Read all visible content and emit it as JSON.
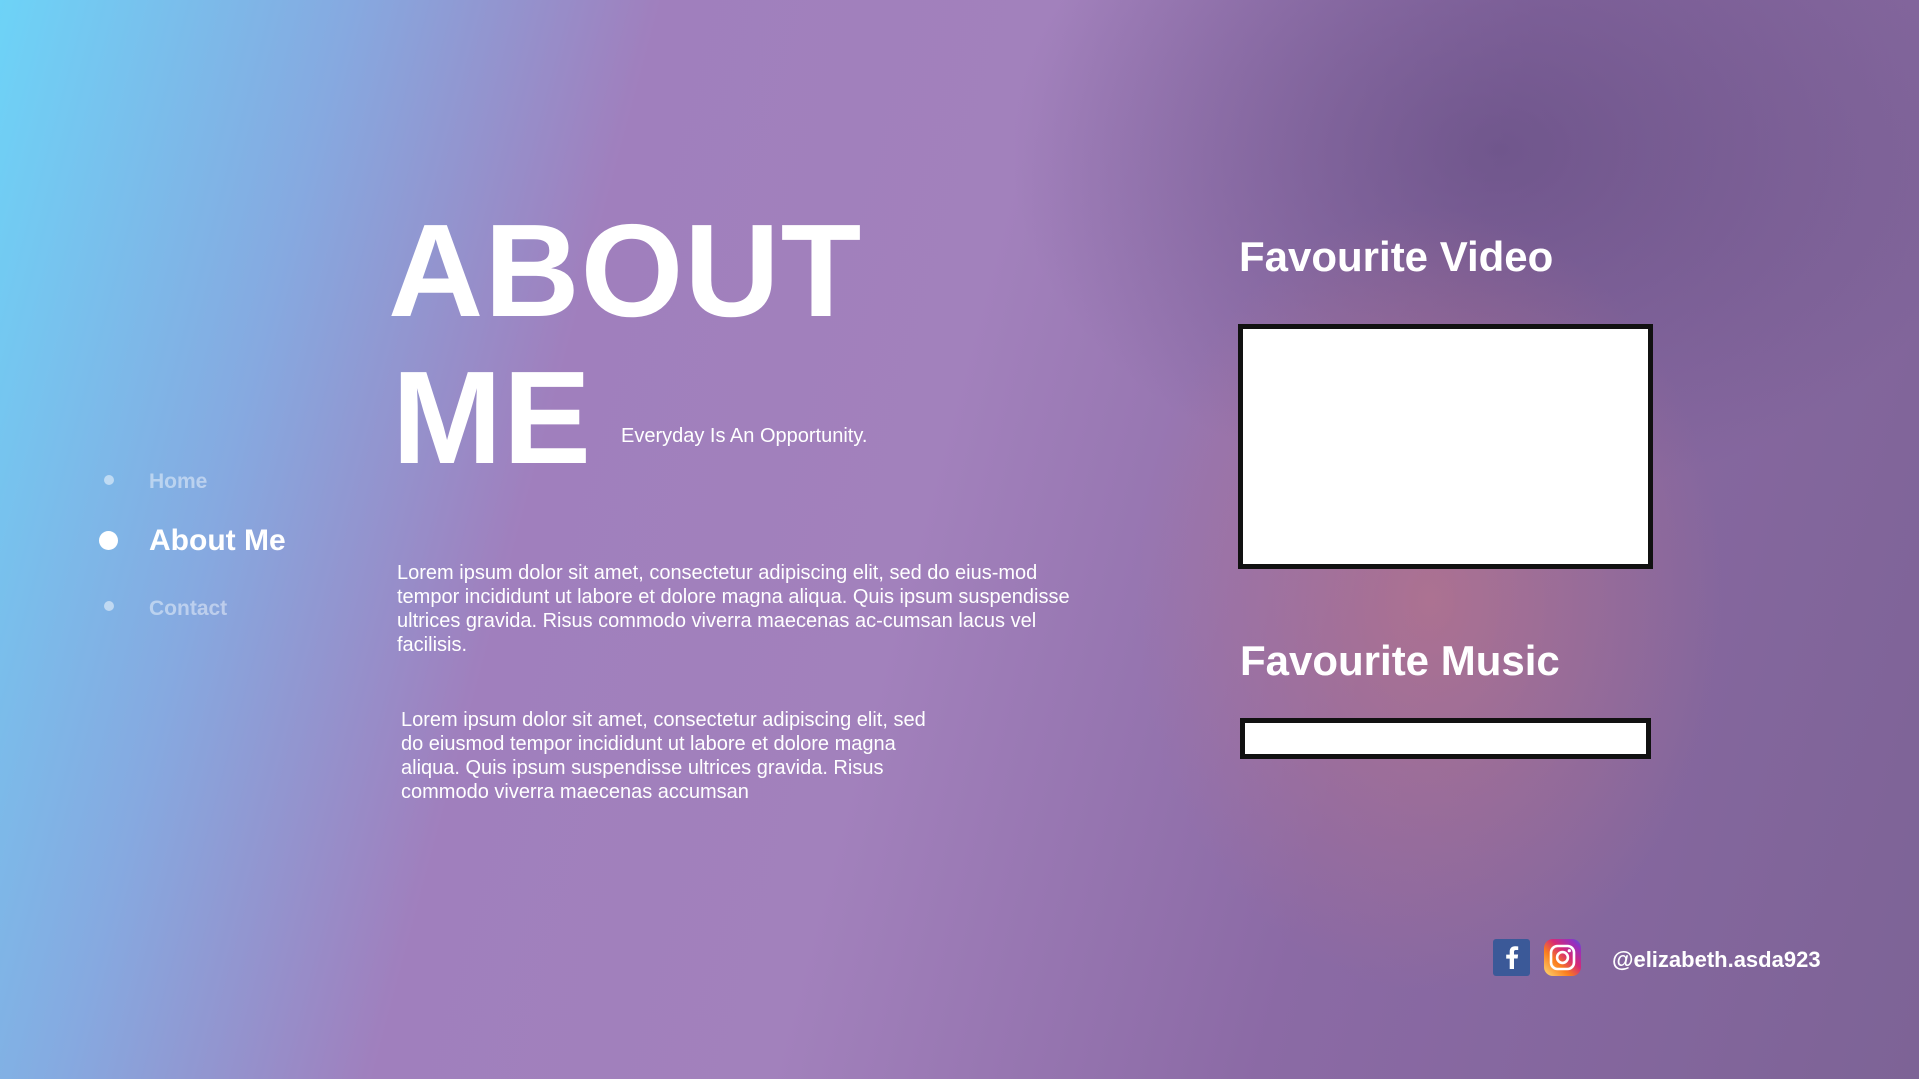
{
  "nav": {
    "items": [
      {
        "label": "Home",
        "active": false
      },
      {
        "label": "About Me",
        "active": true
      },
      {
        "label": "Contact",
        "active": false
      }
    ]
  },
  "hero": {
    "title_line1": "ABOUT",
    "title_line2": "ME",
    "tagline": "Everyday Is  An Opportunity."
  },
  "content": {
    "paragraph1": "Lorem ipsum dolor sit amet, consectetur adipiscing elit, sed do eius-mod tempor incididunt ut labore et dolore magna aliqua. Quis ipsum suspendisse ultrices gravida. Risus commodo viverra maecenas ac-cumsan lacus vel facilisis.",
    "paragraph2": "Lorem ipsum dolor sit amet, consectetur adipiscing elit, sed do eiusmod tempor incididunt ut labore et dolore magna aliqua. Quis ipsum suspendisse ultrices gravida. Risus commodo viverra maecenas accumsan"
  },
  "side": {
    "video_heading": "Favourite Video",
    "music_heading": "Favourite Music"
  },
  "footer": {
    "handle": "@elizabeth.asda923",
    "icons": [
      "facebook-icon",
      "instagram-icon"
    ]
  },
  "colors": {
    "facebook": "#3b5998",
    "gradient_start": "#6dd3f7",
    "gradient_mid": "#a07fbd"
  }
}
